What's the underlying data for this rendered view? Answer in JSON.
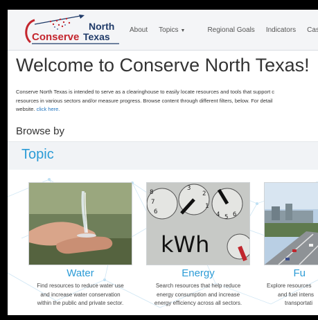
{
  "brand": {
    "line1": "North",
    "line2_a": "Conserve",
    "line2_b": "Texas"
  },
  "nav": {
    "about": "About",
    "topics": "Topics",
    "regional_goals": "Regional Goals",
    "indicators": "Indicators",
    "case_studies": "Case Studi"
  },
  "page": {
    "title": "Welcome to Conserve North Texas!",
    "intro_line1": "Conserve North Texas is intended to serve as a clearinghouse to easily locate resources and tools that support c",
    "intro_line2": "resources in various sectors and/or measure progress. Browse content through different filters, below. For detail",
    "intro_line3": "website.",
    "click_here": "click here.",
    "browse_by": "Browse by",
    "topic": "Topic"
  },
  "cards": [
    {
      "title": "Water",
      "desc1": "Find resources to reduce water use",
      "desc2": "and increase water conservation",
      "desc3": "within the public and private sector."
    },
    {
      "title": "Energy",
      "desc1": "Search resources that help reduce",
      "desc2": "energy consumption and increase",
      "desc3": "energy efficiency across all sectors.",
      "meter_label": "kWh"
    },
    {
      "title": "Fu",
      "desc1": "Explore resources",
      "desc2": "and fuel intens",
      "desc3": "transportati"
    }
  ],
  "colors": {
    "accent": "#2b9bd6",
    "link": "#1e73be",
    "logo_red": "#c4262e",
    "logo_navy": "#1f3a68"
  }
}
